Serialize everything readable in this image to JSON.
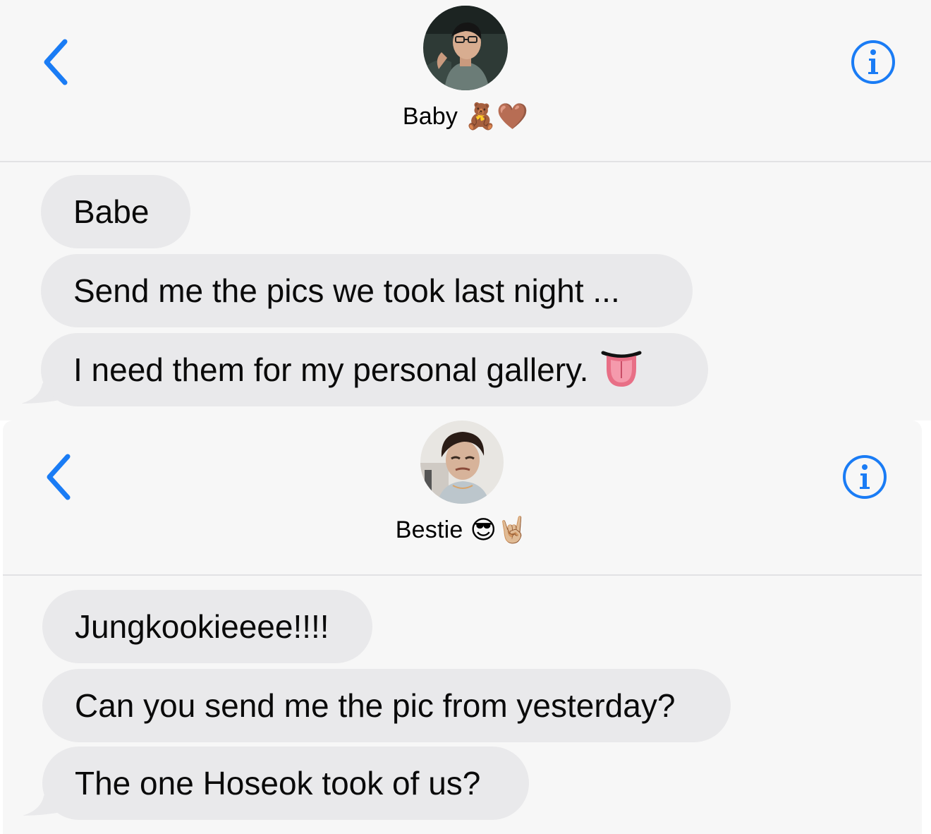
{
  "conversations": [
    {
      "contact": {
        "name": "Baby",
        "emoji": "🧸🤎"
      },
      "messages": [
        {
          "text": "Babe"
        },
        {
          "text": "Send me the pics we took last night ..."
        },
        {
          "text": "I need them for my personal gallery.",
          "emoji": "😛"
        }
      ]
    },
    {
      "contact": {
        "name": "Bestie",
        "emoji": "😎🤘🏼"
      },
      "messages": [
        {
          "text": "Jungkookieeee!!!!"
        },
        {
          "text": "Can you send me the pic from yesterday?"
        },
        {
          "text": "The one Hoseok took of us?"
        }
      ]
    }
  ],
  "icons": {
    "back": "chevron-left-icon",
    "info": "info-circle-icon"
  },
  "colors": {
    "accent": "#1a7cf5",
    "bubble": "#e9e9eb",
    "background": "#f7f7f7",
    "divider": "#e2e2e4"
  }
}
